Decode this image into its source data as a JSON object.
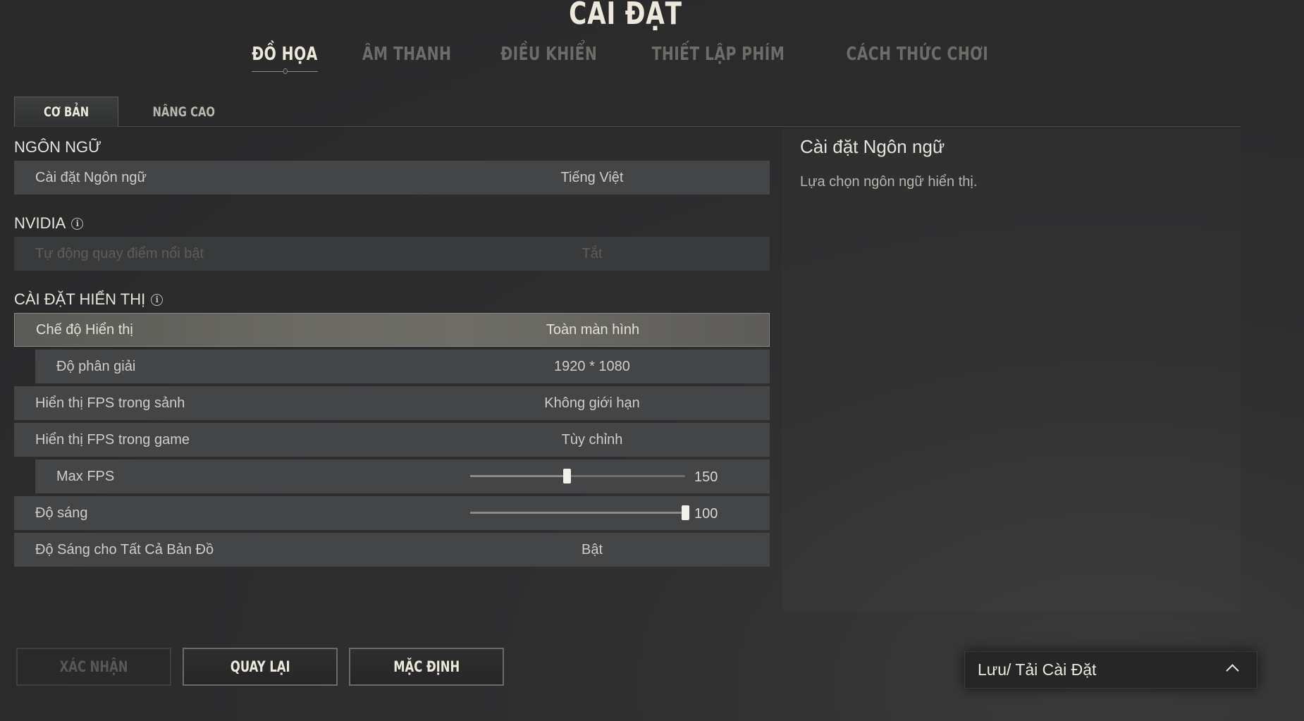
{
  "header": {
    "title": "CÀI ĐẶT",
    "tabs": [
      {
        "label": "ĐỒ HỌA",
        "active": true
      },
      {
        "label": "ÂM THANH",
        "active": false
      },
      {
        "label": "ĐIỀU KHIỂN",
        "active": false
      },
      {
        "label": "THIẾT LẬP PHÍM",
        "active": false
      },
      {
        "label": "CÁCH THỨC CHƠI",
        "active": false
      }
    ]
  },
  "sub_tabs": [
    {
      "label": "CƠ BẢN",
      "active": true
    },
    {
      "label": "NÂNG CAO",
      "active": false
    }
  ],
  "sections": {
    "language": {
      "title": "NGÔN NGỮ",
      "rows": [
        {
          "label": "Cài đặt Ngôn ngữ",
          "value": "Tiếng Việt"
        }
      ]
    },
    "nvidia": {
      "title": "NVIDIA",
      "rows": [
        {
          "label": "Tự động quay điểm nổi bật",
          "value": "Tắt",
          "disabled": true
        }
      ]
    },
    "display": {
      "title": "CÀI ĐẶT HIỂN THỊ",
      "rows": [
        {
          "label": "Chế độ Hiển thị",
          "value": "Toàn màn hình"
        },
        {
          "label": "Độ phân giải",
          "value": "1920 * 1080"
        },
        {
          "label": "Hiển thị FPS trong sảnh",
          "value": "Không giới hạn"
        },
        {
          "label": "Hiển thị FPS trong game",
          "value": "Tùy chỉnh"
        },
        {
          "label": "Max FPS",
          "value": "150",
          "slider_fraction": 0.45
        },
        {
          "label": "Độ sáng",
          "value": "100",
          "slider_fraction": 1.0
        },
        {
          "label": "Độ Sáng cho Tất Cả Bản Đồ",
          "value": "Bật"
        }
      ]
    }
  },
  "right_panel": {
    "title": "Cài đặt Ngôn ngữ",
    "description": "Lựa chọn ngôn ngữ hiển thị."
  },
  "buttons": {
    "confirm": "XÁC NHẬN",
    "back": "QUAY LẠI",
    "default": "MẶC ĐỊNH"
  },
  "save_load": {
    "label": "Lưu/ Tải Cài Đặt"
  },
  "icons": {
    "info": "info-icon",
    "chevron": "chevron-up-icon"
  },
  "colors": {
    "background": "#2d2d2e",
    "row": "#444546",
    "highlight_row": "#6b6a64",
    "text": "#d8d6cf"
  }
}
